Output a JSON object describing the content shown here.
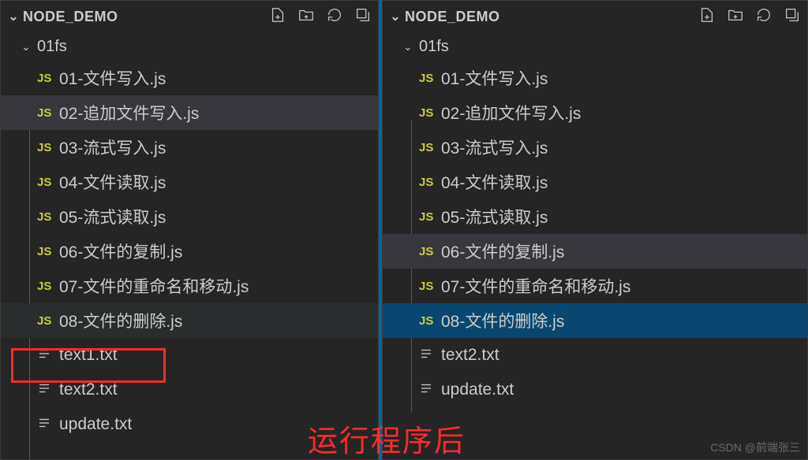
{
  "left": {
    "title": "NODE_DEMO",
    "folder": "01fs",
    "files": [
      {
        "icon": "js",
        "name": "01-文件写入.js",
        "state": ""
      },
      {
        "icon": "js",
        "name": "02-追加文件写入.js",
        "state": "active-02"
      },
      {
        "icon": "js",
        "name": "03-流式写入.js",
        "state": ""
      },
      {
        "icon": "js",
        "name": "04-文件读取.js",
        "state": ""
      },
      {
        "icon": "js",
        "name": "05-流式读取.js",
        "state": ""
      },
      {
        "icon": "js",
        "name": "06-文件的复制.js",
        "state": ""
      },
      {
        "icon": "js",
        "name": "07-文件的重命名和移动.js",
        "state": ""
      },
      {
        "icon": "js",
        "name": "08-文件的删除.js",
        "state": "active-08"
      },
      {
        "icon": "txt",
        "name": "text1.txt",
        "state": ""
      },
      {
        "icon": "txt",
        "name": "text2.txt",
        "state": ""
      },
      {
        "icon": "txt",
        "name": "update.txt",
        "state": ""
      }
    ]
  },
  "right": {
    "title": "NODE_DEMO",
    "folder": "01fs",
    "files": [
      {
        "icon": "js",
        "name": "01-文件写入.js",
        "state": ""
      },
      {
        "icon": "js",
        "name": "02-追加文件写入.js",
        "state": ""
      },
      {
        "icon": "js",
        "name": "03-流式写入.js",
        "state": ""
      },
      {
        "icon": "js",
        "name": "04-文件读取.js",
        "state": ""
      },
      {
        "icon": "js",
        "name": "05-流式读取.js",
        "state": ""
      },
      {
        "icon": "js",
        "name": "06-文件的复制.js",
        "state": "active-06"
      },
      {
        "icon": "js",
        "name": "07-文件的重命名和移动.js",
        "state": ""
      },
      {
        "icon": "js",
        "name": "08-文件的删除.js",
        "state": "sel-08"
      },
      {
        "icon": "txt",
        "name": "text2.txt",
        "state": ""
      },
      {
        "icon": "txt",
        "name": "update.txt",
        "state": ""
      }
    ]
  },
  "annotation": "运行程序后",
  "watermark": "CSDN @前端张三",
  "icon_labels": {
    "js": "JS"
  }
}
